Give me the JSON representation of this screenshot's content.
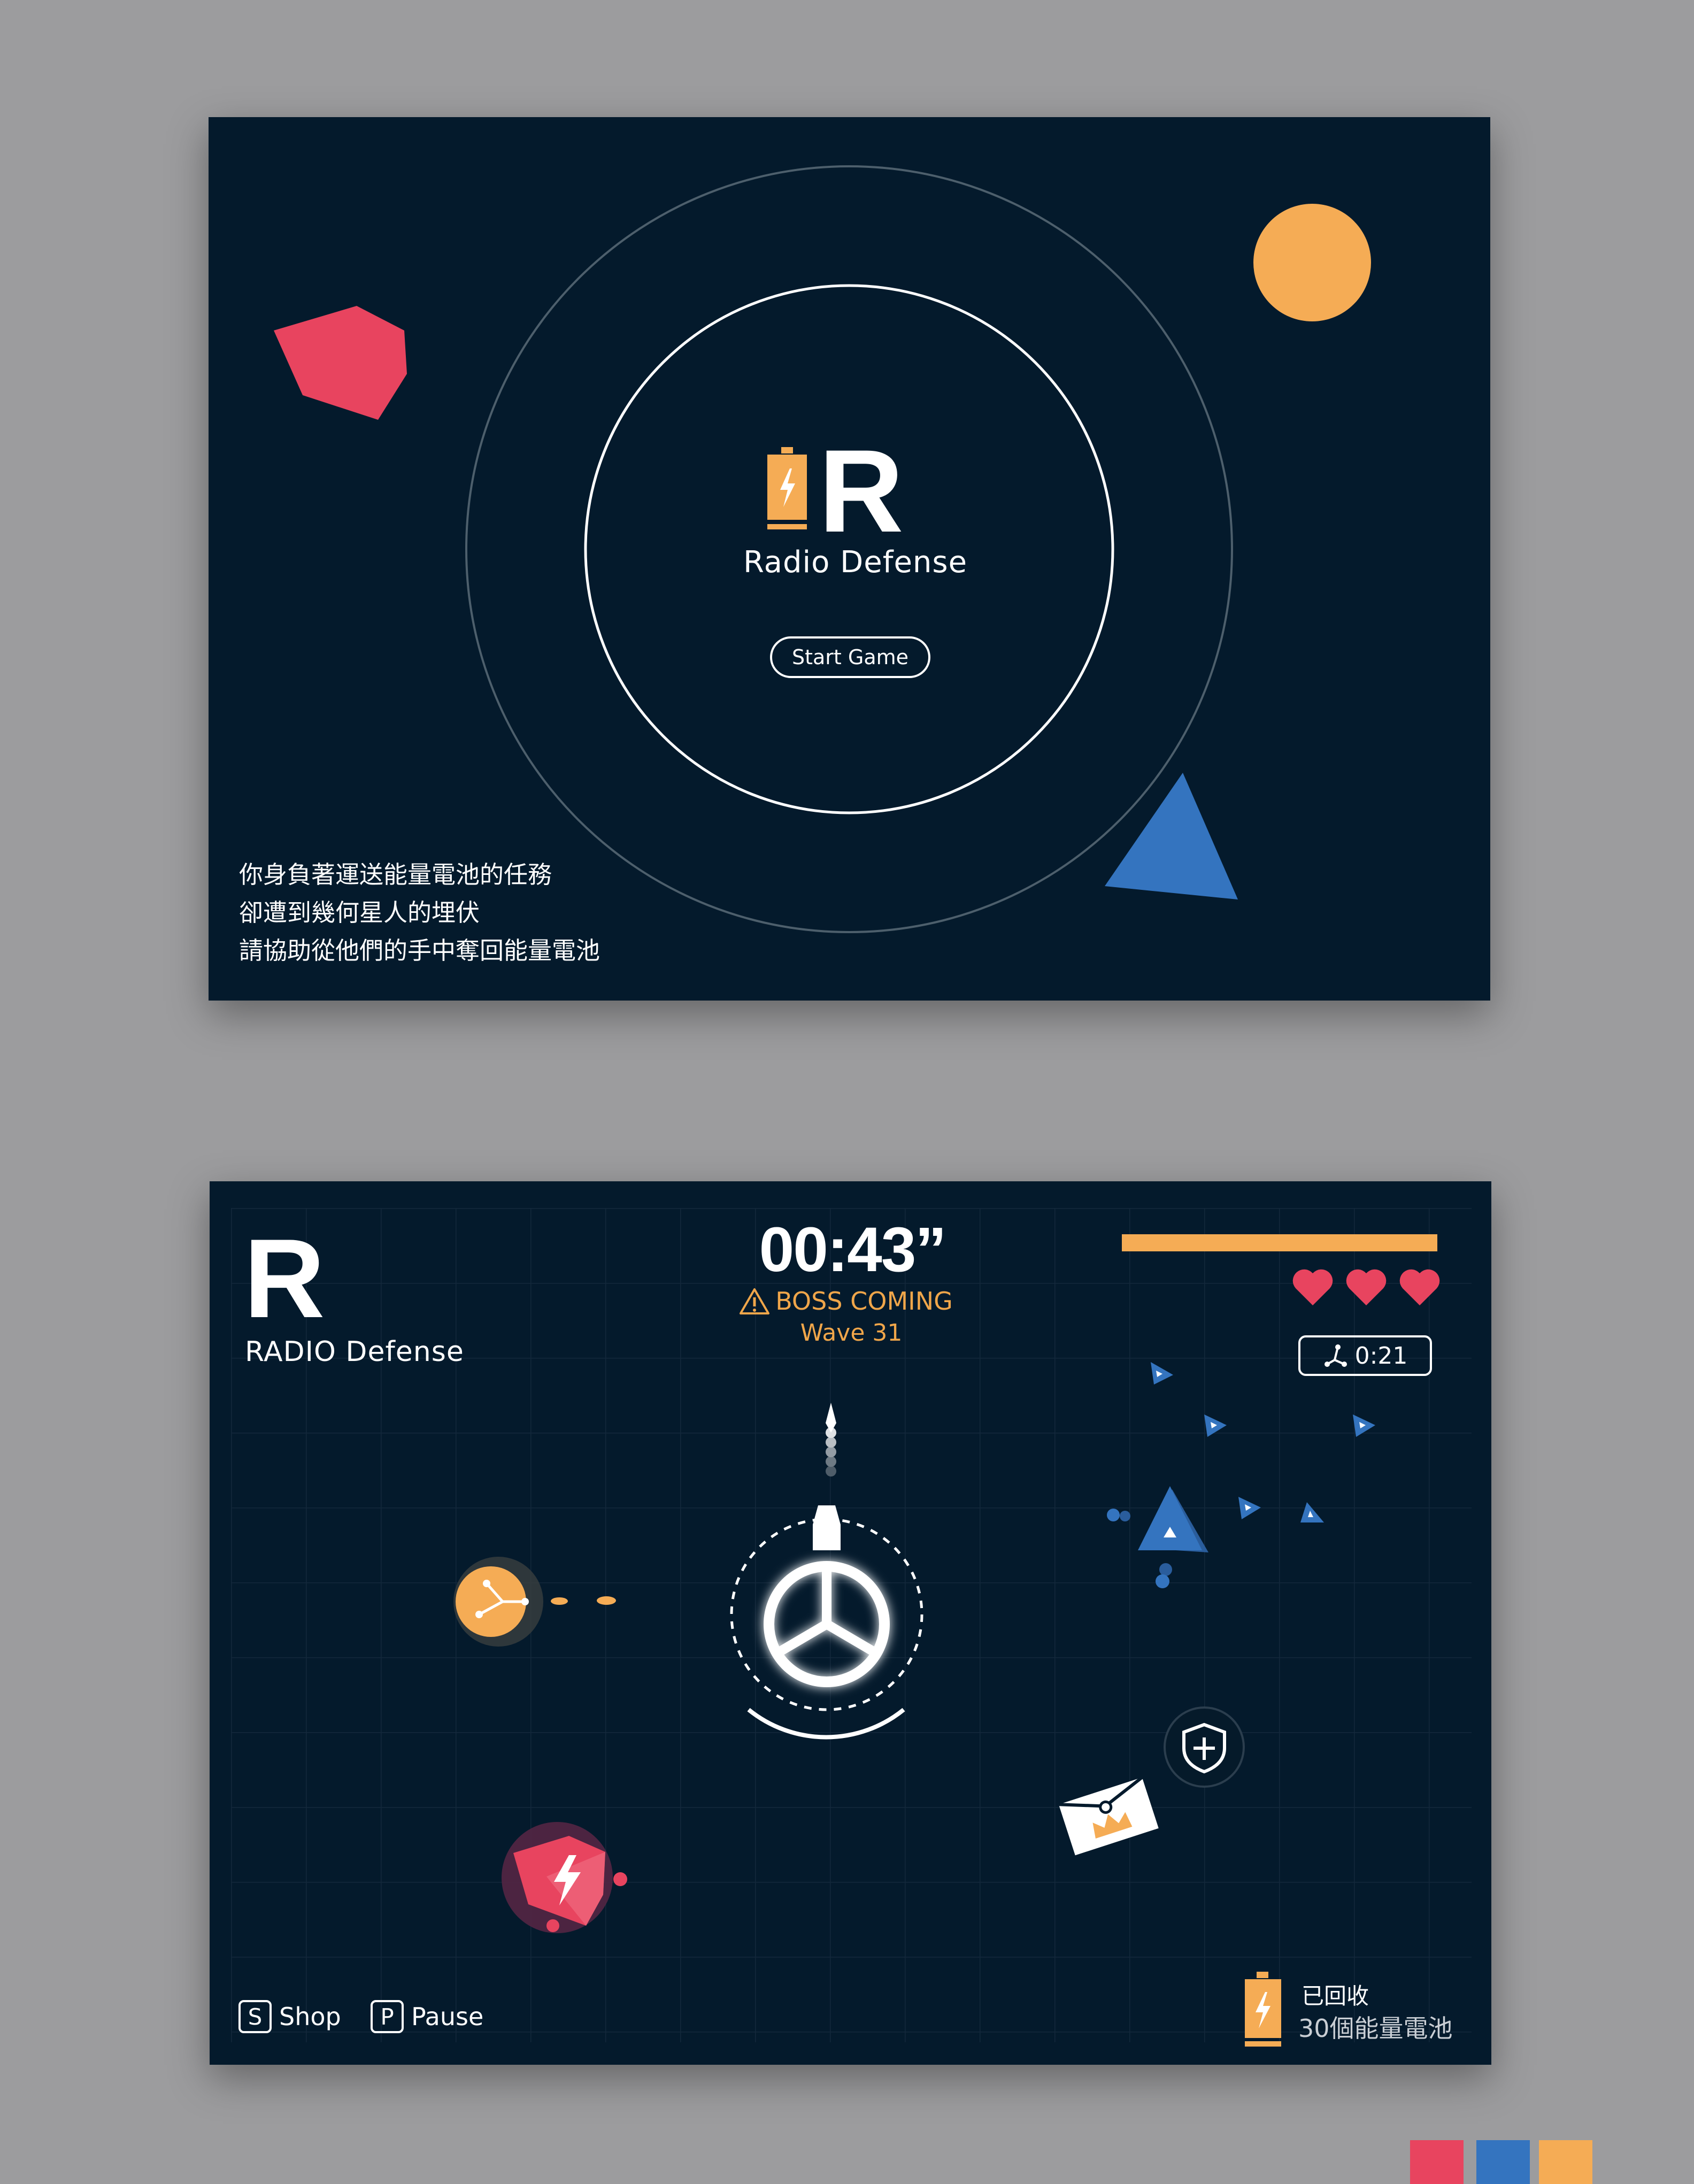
{
  "title_screen": {
    "app_name": "Radio Defense",
    "logo_letter": "R",
    "start_button": "Start Game",
    "story_lines": [
      "你身負著運送能量電池的任務",
      "卻遭到幾何星人的埋伏",
      "請協助從他們的手中奪回能量電池"
    ]
  },
  "game_screen": {
    "logo_letter": "R",
    "game_name": "RADIO Defense",
    "timer": "00:43”",
    "boss_warning": "BOSS COMING",
    "wave": "Wave 31",
    "lives": 3,
    "energy_level": 1.0,
    "skill_cooldown": "0:21",
    "shop": {
      "key": "S",
      "label": "Shop"
    },
    "pause": {
      "key": "P",
      "label": "Pause"
    },
    "collected_label": "已回收",
    "collected_count": "30個能量電池"
  },
  "colors": {
    "background": "#041a2c",
    "page": "#9c9c9e",
    "accent_orange": "#f5ac55",
    "accent_red": "#e8445f",
    "accent_blue": "#3474bf",
    "white": "#ffffff"
  },
  "palette_swatches": [
    "#e8445f",
    "#3474bf",
    "#f5ac55"
  ]
}
